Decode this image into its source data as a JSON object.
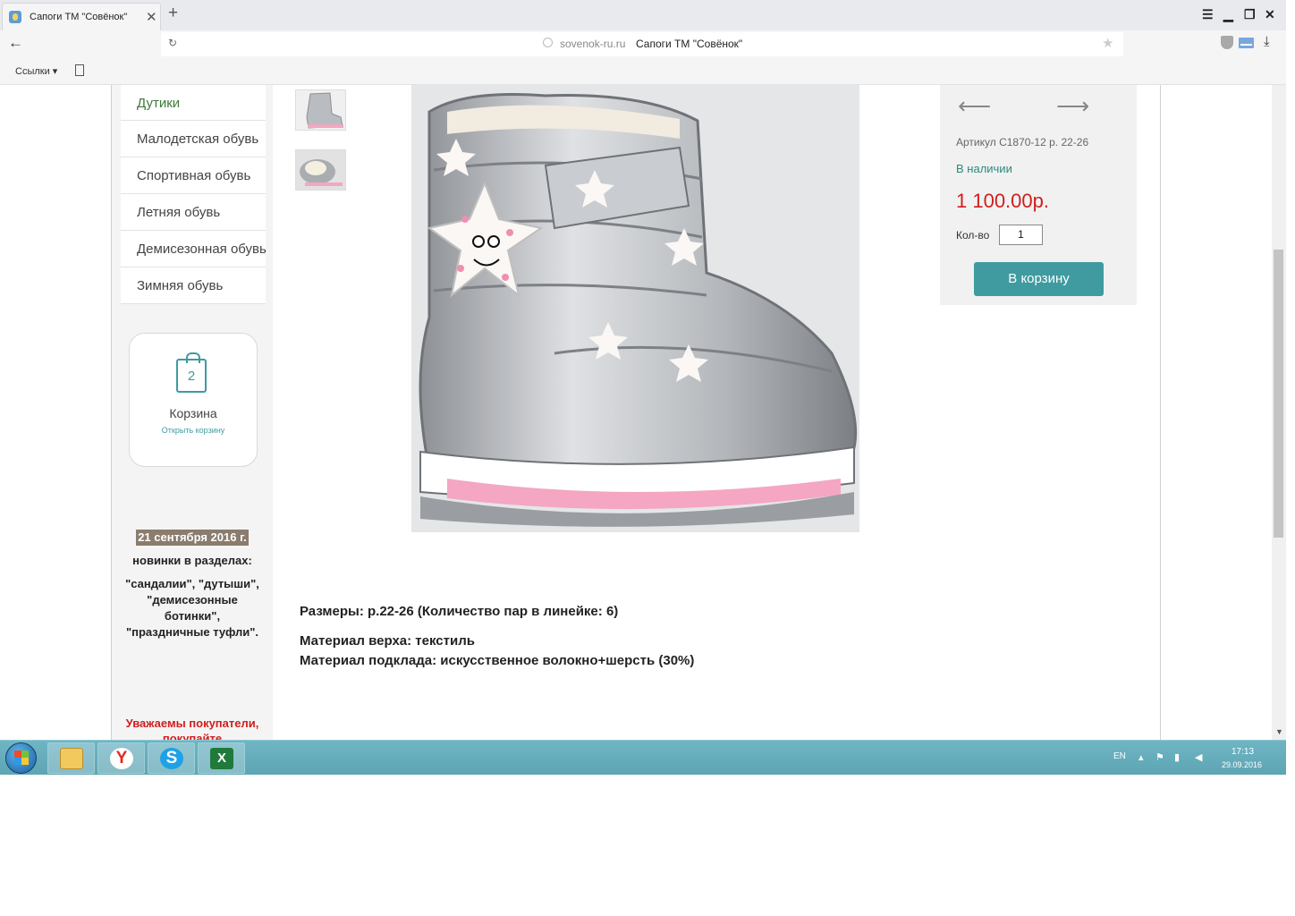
{
  "browser": {
    "tab_title": "Сапоги ТМ \"Совёнок\"",
    "tab_close": "✕",
    "new_tab": "+",
    "window_controls": {
      "menu": "☰",
      "minimize": "▁",
      "restore": "❐",
      "close": "✕"
    },
    "back": "←",
    "reload": "↻",
    "url_host": "sovenok-ru.ru",
    "url_title": "Сапоги ТМ \"Совёнок\"",
    "star": "★",
    "download": "⤓",
    "bookmarks_label": "Ссылки ▾"
  },
  "sidebar": {
    "menu": [
      "Дутики",
      "Малодетская обувь",
      "Спортивная обувь",
      "Летняя обувь",
      "Демисезонная обувь",
      "Зимняя обувь"
    ],
    "cart": {
      "count": "2",
      "title": "Корзина",
      "link": "Открыть корзину"
    },
    "news": {
      "date": "21 сентября 2016 г.",
      "heading": "новинки в разделах:",
      "lines": [
        "\"сандалии\", \"дутыши\",",
        "\"демисезонные",
        "ботинки\",",
        "\"праздничные туфли\"."
      ]
    },
    "notice": "Уважаемы покупатели,",
    "notice_cut": "покупайте"
  },
  "product": {
    "prev_arrow": "⟵",
    "next_arrow": "⟶",
    "sku": "Артикул C1870-12 р. 22-26",
    "stock": "В наличии",
    "price": "1 100.00р.",
    "qty_label": "Кол-во",
    "qty_value": "1",
    "buy_button": "В корзину",
    "description": [
      "Размеры: р.22-26 (Количество пар в линейке: 6)",
      "Материал верха: текстиль",
      "Материал подклада: искусственное волокно+шерсть (30%)"
    ]
  },
  "taskbar": {
    "apps": [
      "folder-icon",
      "yandex-icon",
      "skype-icon",
      "excel-icon"
    ],
    "yandex_letter": "Y",
    "skype_letter": "S",
    "excel_letter": "X",
    "lang": "EN",
    "tray_up": "▴",
    "time": "17:13",
    "date": "29.09.2016"
  }
}
